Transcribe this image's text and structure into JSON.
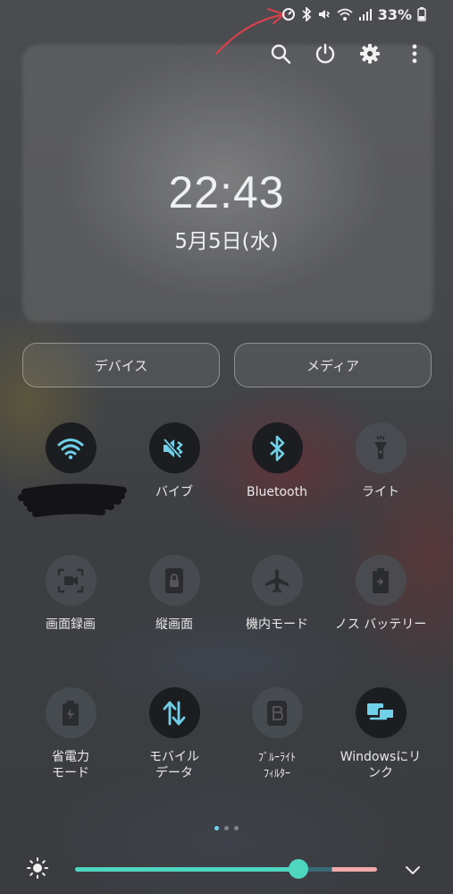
{
  "status_bar": {
    "battery": "33%",
    "icons": [
      "data-saver-icon",
      "bluetooth-icon",
      "vibrate-icon",
      "wifi-icon",
      "signal-icon",
      "battery-icon"
    ]
  },
  "top_actions": [
    "search-icon",
    "power-icon",
    "settings-gear-icon",
    "more-vertical-icon"
  ],
  "clock": {
    "time": "22:43",
    "date": "5月5日(水)"
  },
  "buttons": {
    "devices": "デバイス",
    "media": "メディア"
  },
  "tiles": [
    {
      "label": "",
      "icon": "wifi-icon",
      "active": true
    },
    {
      "label": "バイブ",
      "icon": "vibrate-icon",
      "active": true
    },
    {
      "label": "Bluetooth",
      "icon": "bluetooth-icon",
      "active": true
    },
    {
      "label": "ライト",
      "icon": "flashlight-icon",
      "active": false
    },
    {
      "label": "画面録画",
      "icon": "screen-record-icon",
      "active": false
    },
    {
      "label": "縦画面",
      "icon": "portrait-lock-icon",
      "active": false
    },
    {
      "label": "機内モード",
      "icon": "airplane-icon",
      "active": false
    },
    {
      "label": "ノス バッテリー",
      "icon": "battery-share-icon",
      "active": false
    },
    {
      "label": "省電力\nモード",
      "icon": "power-saving-icon",
      "active": false
    },
    {
      "label": "モバイル\nデータ",
      "icon": "mobile-data-icon",
      "active": true
    },
    {
      "label": "ﾌﾞﾙｰﾗｲﾄ\nﾌｨﾙﾀｰ",
      "icon": "blue-light-filter-icon",
      "active": false
    },
    {
      "label": "Windowsにリ\nンク",
      "icon": "link-to-windows-icon",
      "active": true
    }
  ],
  "colors": {
    "accent": "#6fd0e8",
    "slider": "#4fd6c0",
    "slider_warm": "#f0a8a8"
  },
  "brightness": {
    "level": 0.74
  }
}
